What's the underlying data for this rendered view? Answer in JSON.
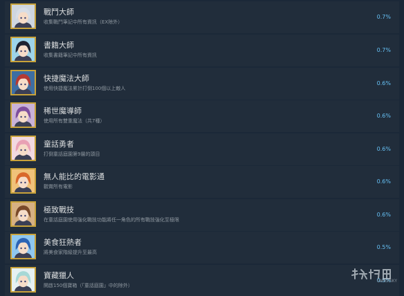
{
  "achievements": [
    {
      "title": "戰鬥大師",
      "description": "收集戰鬥筆記中所有資訊（EX除外）",
      "percent": "0.7%",
      "icon": "achievement-icon-silver-hair-girl",
      "hair": "#d7dde6",
      "bg": "#cfd6df"
    },
    {
      "title": "書籍大師",
      "description": "收集書籍筆記中所有資訊",
      "percent": "0.7%",
      "icon": "achievement-icon-dark-hair-swordsman",
      "hair": "#1e2230",
      "bg": "#9dd4ea"
    },
    {
      "title": "快捷魔法大師",
      "description": "使用快捷魔法累計打倒100個以上敵人",
      "percent": "0.6%",
      "icon": "achievement-icon-red-hair-mage",
      "hair": "#b53a33",
      "bg": "#3d6ea3"
    },
    {
      "title": "稀世魔導師",
      "description": "使用所有雙重魔法（共7種）",
      "percent": "0.6%",
      "icon": "achievement-icon-purple-hair-girl",
      "hair": "#7f4f9e",
      "bg": "#c9b2d8"
    },
    {
      "title": "童話勇者",
      "description": "打倒童話庭園第9層的頭目",
      "percent": "0.6%",
      "icon": "achievement-icon-pink-hair-girl",
      "hair": "#e8a1b4",
      "bg": "#f2d9e0"
    },
    {
      "title": "無人能比的電影通",
      "description": "觀賞所有電影",
      "percent": "0.6%",
      "icon": "achievement-icon-orange-hair-girl",
      "hair": "#d9682c",
      "bg": "#f0c27a"
    },
    {
      "title": "極致戰技",
      "description": "在童話庭園使用強化戰技功能將任一角色的所有戰技強化至極限",
      "percent": "0.6%",
      "icon": "achievement-icon-brown-hair-boy",
      "hair": "#7a4a2a",
      "bg": "#d6b083"
    },
    {
      "title": "美食狂熱者",
      "description": "將美食家階級提升至最高",
      "percent": "0.5%",
      "icon": "achievement-icon-blue-hair-girl",
      "hair": "#2c63b5",
      "bg": "#8fc7ef"
    },
    {
      "title": "寶藏獵人",
      "description": "開啟150個寶箱（「童話庭園」中的除外）",
      "percent": "0.5%",
      "icon": "achievement-icon-teal-hair-maid",
      "hair": "#a6d8d6",
      "bg": "#e6f1f2"
    }
  ],
  "watermark": {
    "icon": "youxia-watermark-logo",
    "text": "GAMERSKY"
  }
}
